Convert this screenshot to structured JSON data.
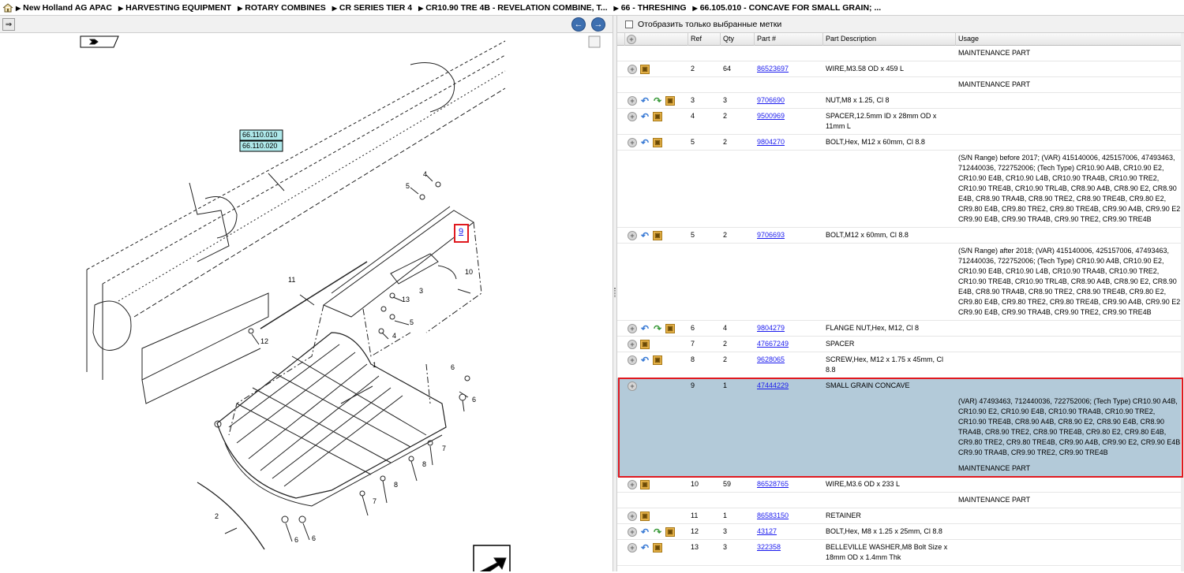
{
  "breadcrumbs": [
    "New Holland AG APAC",
    "HARVESTING EQUIPMENT",
    "ROTARY COMBINES",
    "CR SERIES TIER 4",
    "CR10.90 TRE 4B - REVELATION COMBINE, T...",
    "66 - THRESHING",
    "66.105.010 - CONCAVE FOR SMALL GRAIN; ..."
  ],
  "toolbar": {
    "show_selected_label": "Отобразить только выбранные метки"
  },
  "diagram": {
    "ref_boxes": [
      "66.110.010",
      "66.110.020"
    ],
    "highlight_label": "9",
    "callouts": [
      "1",
      "2",
      "3",
      "3",
      "4",
      "4",
      "5",
      "5",
      "6",
      "6",
      "6",
      "6",
      "7",
      "7",
      "8",
      "8",
      "10",
      "11",
      "12",
      "13"
    ]
  },
  "table": {
    "headers": {
      "ref": "Ref",
      "qty": "Qty",
      "part": "Part #",
      "desc": "Part Description",
      "usage": "Usage"
    },
    "rows": [
      {
        "ref": "",
        "qty": "",
        "part": "",
        "desc": "",
        "usage": "MAINTENANCE PART",
        "icons": []
      },
      {
        "ref": "2",
        "qty": "64",
        "part": "86523697",
        "desc": "WIRE,M3.58 OD x 459 L",
        "usage": "",
        "icons": [
          "exp",
          "box"
        ]
      },
      {
        "ref": "",
        "qty": "",
        "part": "",
        "desc": "",
        "usage": "MAINTENANCE PART",
        "icons": []
      },
      {
        "ref": "3",
        "qty": "3",
        "part": "9706690",
        "desc": "NUT,M8 x 1.25, Cl 8",
        "usage": "",
        "icons": [
          "exp",
          "undo",
          "redo",
          "box"
        ]
      },
      {
        "ref": "4",
        "qty": "2",
        "part": "9500969",
        "desc": "SPACER,12.5mm ID x 28mm OD x 11mm L",
        "usage": "",
        "icons": [
          "exp",
          "undo",
          "box"
        ]
      },
      {
        "ref": "5",
        "qty": "2",
        "part": "9804270",
        "desc": "BOLT,Hex, M12 x 60mm, Cl 8.8",
        "usage": "",
        "icons": [
          "exp",
          "undo",
          "box"
        ]
      },
      {
        "ref": "",
        "qty": "",
        "part": "",
        "desc": "",
        "usage": "(S/N Range) before 2017; (VAR) 415140006, 425157006, 47493463, 712440036, 722752006; (Tech Type) CR10.90 A4B, CR10.90 E2, CR10.90 E4B, CR10.90 L4B, CR10.90 TRA4B, CR10.90 TRE2, CR10.90 TRE4B, CR10.90 TRL4B, CR8.90 A4B, CR8.90 E2, CR8.90 E4B, CR8.90 TRA4B, CR8.90 TRE2, CR8.90 TRE4B, CR9.80 E2, CR9.80 E4B, CR9.80 TRE2, CR9.80 TRE4B, CR9.90 A4B, CR9.90 E2, CR9.90 E4B, CR9.90 TRA4B, CR9.90 TRE2, CR9.90 TRE4B",
        "icons": []
      },
      {
        "ref": "5",
        "qty": "2",
        "part": "9706693",
        "desc": "BOLT,M12 x 60mm, Cl 8.8",
        "usage": "",
        "icons": [
          "exp",
          "undo",
          "box"
        ]
      },
      {
        "ref": "",
        "qty": "",
        "part": "",
        "desc": "",
        "usage": "(S/N Range) after 2018; (VAR) 415140006, 425157006, 47493463, 712440036, 722752006; (Tech Type) CR10.90 A4B, CR10.90 E2, CR10.90 E4B, CR10.90 L4B, CR10.90 TRA4B, CR10.90 TRE2, CR10.90 TRE4B, CR10.90 TRL4B, CR8.90 A4B, CR8.90 E2, CR8.90 E4B, CR8.90 TRA4B, CR8.90 TRE2, CR8.90 TRE4B, CR9.80 E2, CR9.80 E4B, CR9.80 TRE2, CR9.80 TRE4B, CR9.90 A4B, CR9.90 E2, CR9.90 E4B, CR9.90 TRA4B, CR9.90 TRE2, CR9.90 TRE4B",
        "icons": []
      },
      {
        "ref": "6",
        "qty": "4",
        "part": "9804279",
        "desc": "FLANGE NUT,Hex, M12, Cl 8",
        "usage": "",
        "icons": [
          "exp",
          "undo",
          "redo",
          "box"
        ]
      },
      {
        "ref": "7",
        "qty": "2",
        "part": "47667249",
        "desc": "SPACER",
        "usage": "",
        "icons": [
          "exp",
          "box"
        ]
      },
      {
        "ref": "8",
        "qty": "2",
        "part": "9628065",
        "desc": "SCREW,Hex, M12 x 1.75 x 45mm, Cl 8.8",
        "usage": "",
        "icons": [
          "exp",
          "undo",
          "box"
        ]
      },
      {
        "ref": "9",
        "qty": "1",
        "part": "47444229",
        "desc": "SMALL GRAIN CONCAVE",
        "usage": "",
        "icons": [
          "exp"
        ],
        "selected": true
      },
      {
        "ref": "",
        "qty": "",
        "part": "",
        "desc": "",
        "usage": "(VAR) 47493463, 712440036, 722752006; (Tech Type) CR10.90 A4B, CR10.90 E2, CR10.90 E4B, CR10.90 TRA4B, CR10.90 TRE2, CR10.90 TRE4B, CR8.90 A4B, CR8.90 E2, CR8.90 E4B, CR8.90 TRA4B, CR8.90 TRE2, CR8.90 TRE4B, CR9.80 E2, CR9.80 E4B, CR9.80 TRE2, CR9.80 TRE4B, CR9.90 A4B, CR9.90 E2, CR9.90 E4B, CR9.90 TRA4B, CR9.90 TRE2, CR9.90 TRE4B",
        "icons": [],
        "selected": true
      },
      {
        "ref": "",
        "qty": "",
        "part": "",
        "desc": "",
        "usage": "MAINTENANCE PART",
        "icons": [],
        "selected": true
      },
      {
        "ref": "10",
        "qty": "59",
        "part": "86528765",
        "desc": "WIRE,M3.6 OD x 233 L",
        "usage": "",
        "icons": [
          "exp",
          "box"
        ]
      },
      {
        "ref": "",
        "qty": "",
        "part": "",
        "desc": "",
        "usage": "MAINTENANCE PART",
        "icons": []
      },
      {
        "ref": "11",
        "qty": "1",
        "part": "86583150",
        "desc": "RETAINER",
        "usage": "",
        "icons": [
          "exp",
          "box"
        ]
      },
      {
        "ref": "12",
        "qty": "3",
        "part": "43127",
        "desc": "BOLT,Hex, M8 x 1.25 x 25mm, Cl 8.8",
        "usage": "",
        "icons": [
          "exp",
          "undo",
          "redo",
          "box"
        ]
      },
      {
        "ref": "13",
        "qty": "3",
        "part": "322358",
        "desc": "BELLEVILLE WASHER,M8 Bolt Size x 18mm OD x 1.4mm Thk",
        "usage": "",
        "icons": [
          "exp",
          "undo",
          "box"
        ]
      }
    ]
  }
}
